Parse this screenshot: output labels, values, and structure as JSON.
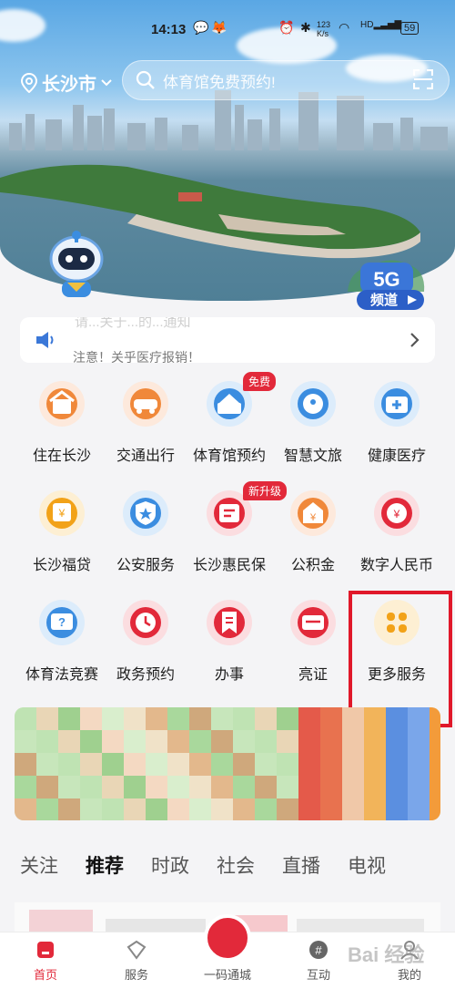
{
  "status": {
    "time": "14:13",
    "speed": "123\nK/s",
    "battery": "59"
  },
  "header": {
    "city": "长沙市",
    "search_placeholder": "体育馆免费预约!"
  },
  "badge": {
    "top": "5G",
    "bottom": "频道"
  },
  "notice": {
    "faded_text": "请...关于...的...通知",
    "text": "注意！关乎医疗报销！"
  },
  "services": [
    {
      "label": "住在长沙",
      "icon": "house-icon",
      "color": "#f0883a",
      "bg": "#fde9dc"
    },
    {
      "label": "交通出行",
      "icon": "car-icon",
      "color": "#f0883a",
      "bg": "#fde9dc"
    },
    {
      "label": "体育馆预约",
      "icon": "stadium-icon",
      "color": "#3b8de0",
      "bg": "#dcecfb",
      "tag": "免费"
    },
    {
      "label": "智慧文旅",
      "icon": "travel-icon",
      "color": "#3b8de0",
      "bg": "#dcecfb"
    },
    {
      "label": "健康医疗",
      "icon": "medical-kit-icon",
      "color": "#3b8de0",
      "bg": "#dcecfb"
    },
    {
      "label": "长沙福贷",
      "icon": "loan-icon",
      "color": "#f2a218",
      "bg": "#fdefd3"
    },
    {
      "label": "公安服务",
      "icon": "police-shield-icon",
      "color": "#3b8de0",
      "bg": "#dcecfb"
    },
    {
      "label": "长沙惠民保",
      "icon": "insurance-icon",
      "color": "#e2293a",
      "bg": "#fbdde0",
      "tag": "新升级"
    },
    {
      "label": "公积金",
      "icon": "fund-icon",
      "color": "#f0883a",
      "bg": "#fde9dc"
    },
    {
      "label": "数字人民币",
      "icon": "digital-yuan-icon",
      "color": "#e2293a",
      "bg": "#fbdde0"
    },
    {
      "label": "体育法竞赛",
      "icon": "quiz-icon",
      "color": "#3b8de0",
      "bg": "#dcecfb"
    },
    {
      "label": "政务预约",
      "icon": "clock-icon",
      "color": "#e2293a",
      "bg": "#fbdde0"
    },
    {
      "label": "办事",
      "icon": "bookmark-icon",
      "color": "#e2293a",
      "bg": "#fbdde0"
    },
    {
      "label": "亮证",
      "icon": "card-icon",
      "color": "#e2293a",
      "bg": "#fbdde0"
    },
    {
      "label": "更多服务",
      "icon": "more-grid-icon",
      "color": "#f2a218",
      "bg": "#fdefd3"
    }
  ],
  "tabs": [
    {
      "label": "关注",
      "active": false
    },
    {
      "label": "推荐",
      "active": true
    },
    {
      "label": "时政",
      "active": false
    },
    {
      "label": "社会",
      "active": false
    },
    {
      "label": "直播",
      "active": false
    },
    {
      "label": "电视",
      "active": false
    }
  ],
  "bottom_nav": [
    {
      "label": "首页",
      "icon": "home-icon",
      "active": true
    },
    {
      "label": "服务",
      "icon": "service-icon",
      "active": false
    },
    {
      "label": "一码通城",
      "icon": "qr-code-icon",
      "active": false
    },
    {
      "label": "互动",
      "icon": "hashtag-icon",
      "active": false
    },
    {
      "label": "我的",
      "icon": "profile-icon",
      "active": false
    }
  ],
  "watermark": "Bai 经验"
}
